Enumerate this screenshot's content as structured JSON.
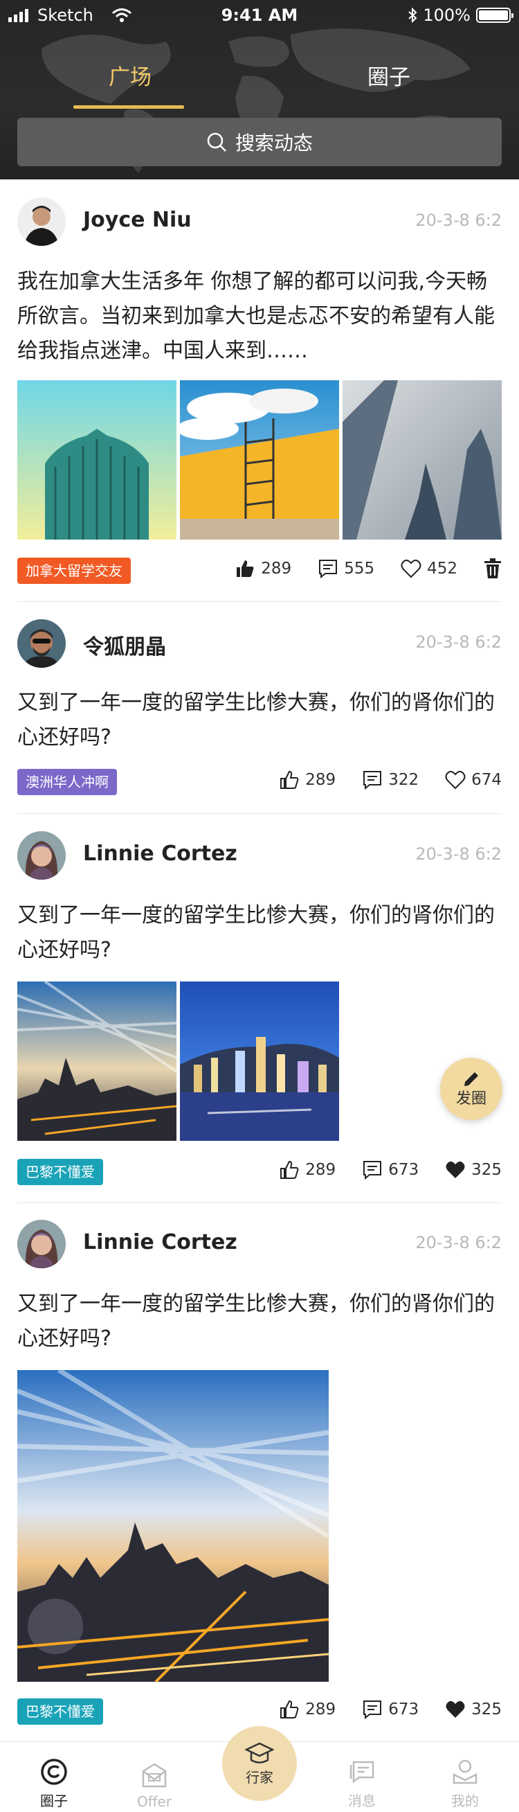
{
  "status_bar": {
    "carrier": "Sketch",
    "time": "9:41 AM",
    "battery": "100%"
  },
  "tabs": [
    {
      "label": "广场",
      "active": true
    },
    {
      "label": "圈子",
      "active": false
    }
  ],
  "search": {
    "placeholder": "搜索动态"
  },
  "posts": [
    {
      "author": "Joyce Niu",
      "time": "20-3-8 6:2",
      "content": "我在加拿大生活多年  你想了解的都可以问我,今天畅所欲言。当初来到加拿大也是忐忑不安的希望有人能给我指点迷津。中国人来到……",
      "tag": "加拿大留学交友",
      "tag_color": "#f15a24",
      "likes": "289",
      "comments": "555",
      "favorites": "452",
      "liked": true,
      "favorited": false,
      "has_delete": true
    },
    {
      "author": "令狐朋晶",
      "time": "20-3-8 6:2",
      "content": "又到了一年一度的留学生比惨大赛，你们的肾你们的心还好吗?",
      "tag": "澳洲华人冲啊",
      "tag_color": "#7b68c9",
      "likes": "289",
      "comments": "322",
      "favorites": "674",
      "liked": false,
      "favorited": false
    },
    {
      "author": "Linnie Cortez",
      "time": "20-3-8 6:2",
      "content": "又到了一年一度的留学生比惨大赛，你们的肾你们的心还好吗?",
      "tag": "巴黎不懂爱",
      "tag_color": "#1aa3b8",
      "likes": "289",
      "comments": "673",
      "favorites": "325",
      "liked": false,
      "favorited": true
    },
    {
      "author": "Linnie Cortez",
      "time": "20-3-8 6:2",
      "content": "又到了一年一度的留学生比惨大赛，你们的肾你们的心还好吗?",
      "tag": "巴黎不懂爱",
      "tag_color": "#1aa3b8",
      "likes": "289",
      "comments": "673",
      "favorites": "325",
      "liked": false,
      "favorited": true
    }
  ],
  "fab": {
    "label": "发圈"
  },
  "bottom_nav": [
    {
      "label": "圈子",
      "icon": "circle-chat-icon",
      "active": true
    },
    {
      "label": "Offer",
      "icon": "offer-box-icon",
      "active": false
    },
    {
      "label": "行家",
      "icon": "graduation-cap-icon",
      "active": false
    },
    {
      "label": "消息",
      "icon": "message-icon",
      "active": false
    },
    {
      "label": "我的",
      "icon": "profile-icon",
      "active": false
    }
  ]
}
